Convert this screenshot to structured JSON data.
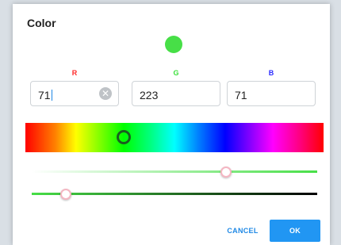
{
  "dialog": {
    "title": "Color",
    "preview_color": "#47df47"
  },
  "channels": {
    "r": {
      "label": "R",
      "value": "71",
      "color": "#ff2a2a"
    },
    "g": {
      "label": "G",
      "value": "223",
      "color": "#3ce03c"
    },
    "b": {
      "label": "B",
      "value": "71",
      "color": "#2a2aff"
    }
  },
  "sliders": {
    "hue_level": 0.33,
    "saturation_level": 0.68,
    "value_level": 0.12
  },
  "buttons": {
    "cancel": "CANCEL",
    "ok": "OK"
  },
  "icons": {
    "clear": "clear-icon"
  }
}
